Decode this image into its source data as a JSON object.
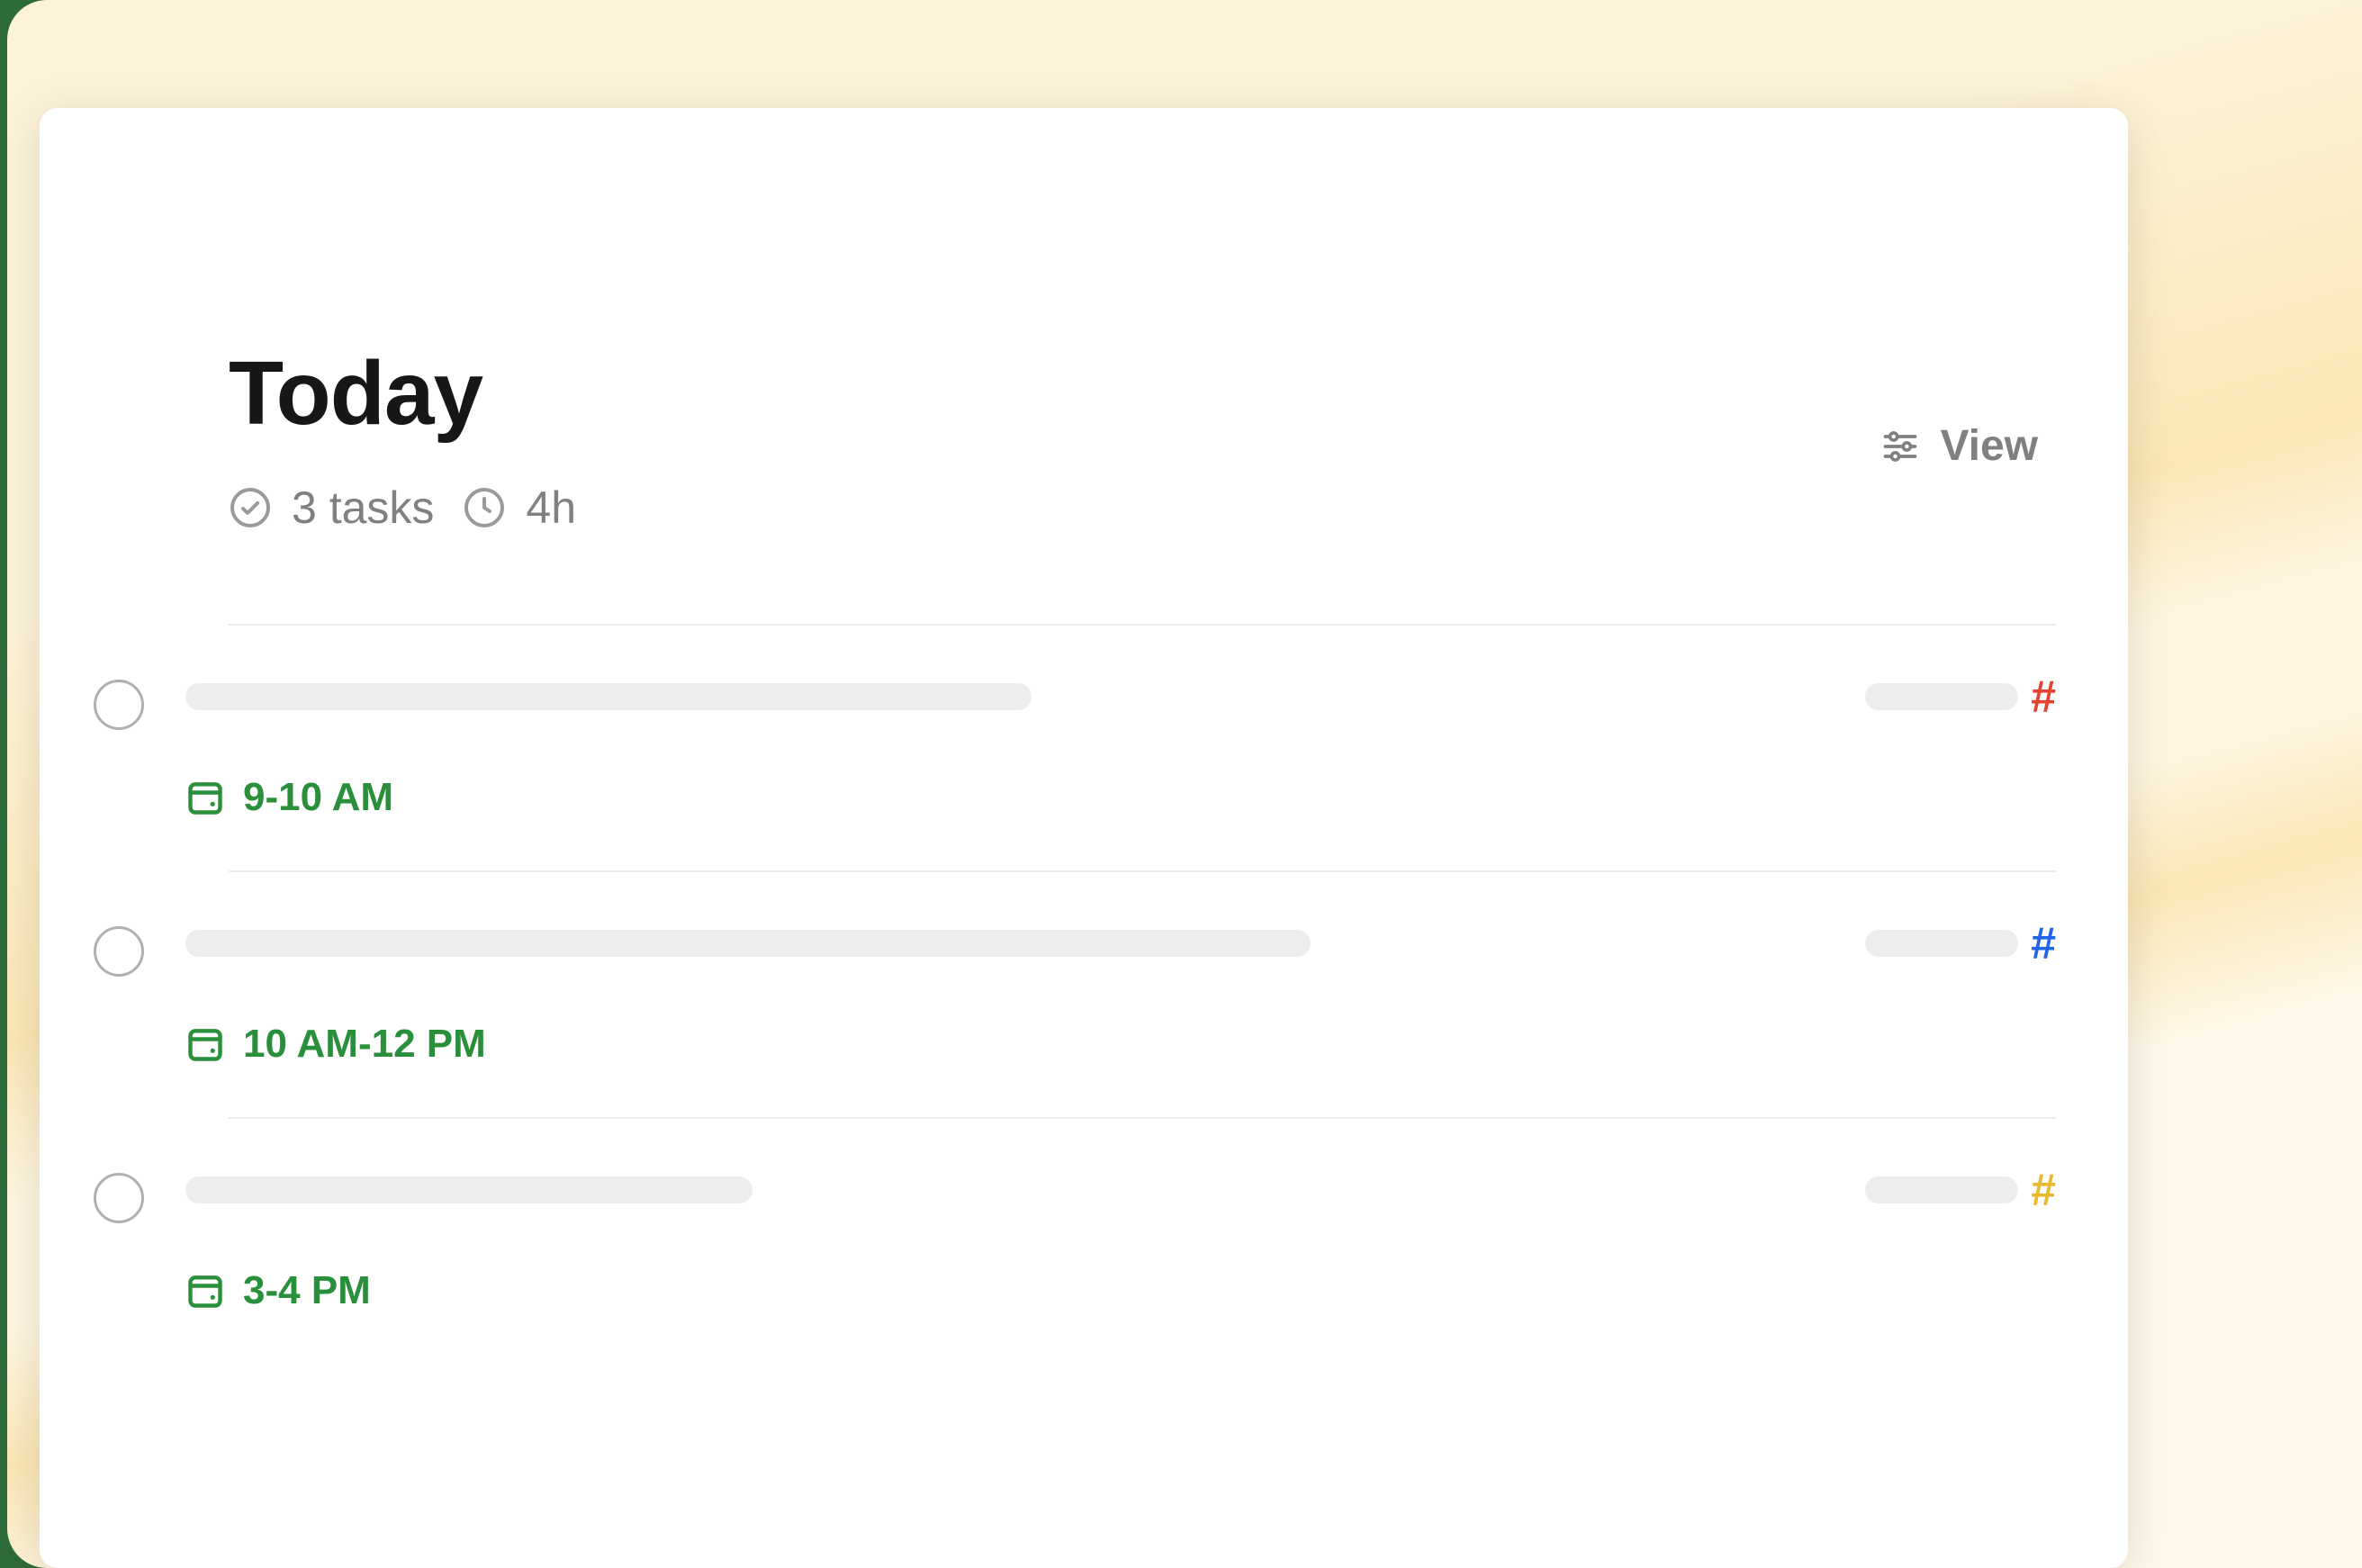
{
  "header": {
    "title": "Today",
    "tasks_count": "3 tasks",
    "duration": "4h",
    "view_label": "View"
  },
  "tasks": [
    {
      "time": "9-10 AM",
      "project_color": "red",
      "hash": "#"
    },
    {
      "time": "10 AM-12 PM",
      "project_color": "blue",
      "hash": "#"
    },
    {
      "time": "3-4 PM",
      "project_color": "yellow",
      "hash": "#"
    }
  ],
  "icons": {
    "check": "check-circle-icon",
    "clock": "clock-icon",
    "sliders": "sliders-icon",
    "calendar": "calendar-today-icon"
  }
}
